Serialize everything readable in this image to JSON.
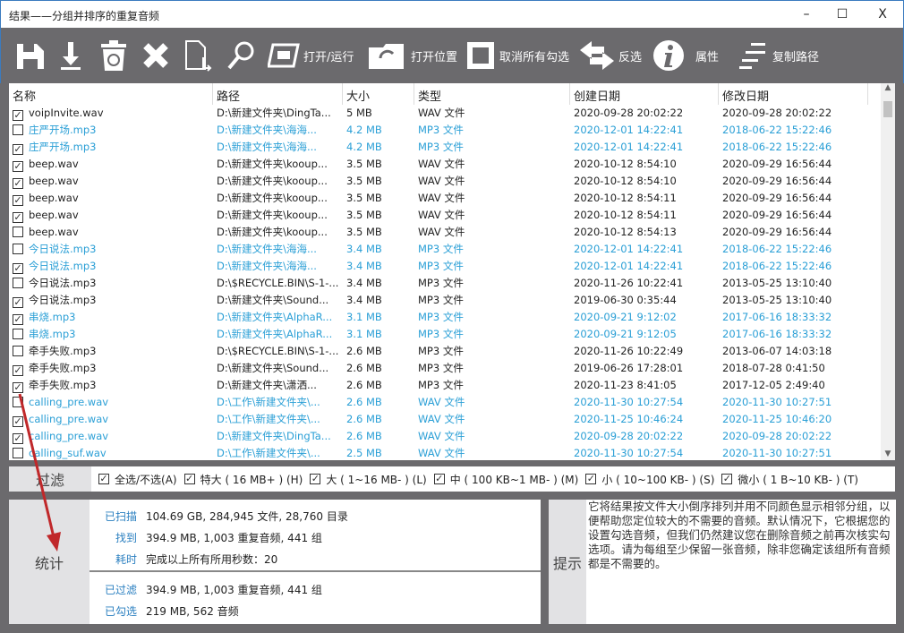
{
  "window": {
    "title": "结果——分组并排序的重复音频",
    "minimize": "–",
    "maximize": "☐",
    "close": "X"
  },
  "toolbar": {
    "open_run": "打开/运行",
    "open_location": "打开位置",
    "uncheck_all": "取消所有勾选",
    "invert": "反选",
    "properties": "属性",
    "copy_path": "复制路径"
  },
  "table": {
    "columns": [
      "名称",
      "路径",
      "大小",
      "类型",
      "创建日期",
      "修改日期"
    ],
    "rows": [
      {
        "checked": true,
        "blue": false,
        "cells": [
          "voipInvite.wav",
          "D:\\新建文件夹\\DingTa...",
          "5 MB",
          "WAV 文件",
          "2020-09-28 20:02:22",
          "2020-09-28 20:02:22"
        ]
      },
      {
        "checked": false,
        "blue": true,
        "cells": [
          "庄严开场.mp3",
          "D:\\新建文件夹\\海海...",
          "4.2 MB",
          "MP3 文件",
          "2020-12-01 14:22:41",
          "2018-06-22 15:22:46"
        ]
      },
      {
        "checked": true,
        "blue": true,
        "cells": [
          "庄严开场.mp3",
          "D:\\新建文件夹\\海海...",
          "4.2 MB",
          "MP3 文件",
          "2020-12-01 14:22:41",
          "2018-06-22 15:22:46"
        ]
      },
      {
        "checked": true,
        "blue": false,
        "cells": [
          "beep.wav",
          "D:\\新建文件夹\\kooup...",
          "3.5 MB",
          "WAV 文件",
          "2020-10-12 8:54:10",
          "2020-09-29 16:56:44"
        ]
      },
      {
        "checked": true,
        "blue": false,
        "cells": [
          "beep.wav",
          "D:\\新建文件夹\\kooup...",
          "3.5 MB",
          "WAV 文件",
          "2020-10-12 8:54:10",
          "2020-09-29 16:56:44"
        ]
      },
      {
        "checked": true,
        "blue": false,
        "cells": [
          "beep.wav",
          "D:\\新建文件夹\\kooup...",
          "3.5 MB",
          "WAV 文件",
          "2020-10-12 8:54:11",
          "2020-09-29 16:56:44"
        ]
      },
      {
        "checked": true,
        "blue": false,
        "cells": [
          "beep.wav",
          "D:\\新建文件夹\\kooup...",
          "3.5 MB",
          "WAV 文件",
          "2020-10-12 8:54:11",
          "2020-09-29 16:56:44"
        ]
      },
      {
        "checked": false,
        "blue": false,
        "cells": [
          "beep.wav",
          "D:\\新建文件夹\\kooup...",
          "3.5 MB",
          "WAV 文件",
          "2020-10-12 8:54:13",
          "2020-09-29 16:56:44"
        ]
      },
      {
        "checked": false,
        "blue": true,
        "cells": [
          "今日说法.mp3",
          "D:\\新建文件夹\\海海...",
          "3.4 MB",
          "MP3 文件",
          "2020-12-01 14:22:41",
          "2018-06-22 15:22:46"
        ]
      },
      {
        "checked": true,
        "blue": true,
        "cells": [
          "今日说法.mp3",
          "D:\\新建文件夹\\海海...",
          "3.4 MB",
          "MP3 文件",
          "2020-12-01 14:22:41",
          "2018-06-22 15:22:46"
        ]
      },
      {
        "checked": false,
        "blue": false,
        "cells": [
          "今日说法.mp3",
          "D:\\$RECYCLE.BIN\\S-1-...",
          "3.4 MB",
          "MP3 文件",
          "2020-11-26 10:22:41",
          "2013-05-25 13:10:40"
        ]
      },
      {
        "checked": true,
        "blue": false,
        "cells": [
          "今日说法.mp3",
          "D:\\新建文件夹\\Sound...",
          "3.4 MB",
          "MP3 文件",
          "2019-06-30 0:35:44",
          "2013-05-25 13:10:40"
        ]
      },
      {
        "checked": true,
        "blue": true,
        "cells": [
          "串烧.mp3",
          "D:\\新建文件夹\\AlphaR...",
          "3.1 MB",
          "MP3 文件",
          "2020-09-21 9:12:02",
          "2017-06-16 18:33:32"
        ]
      },
      {
        "checked": false,
        "blue": true,
        "cells": [
          "串烧.mp3",
          "D:\\新建文件夹\\AlphaR...",
          "3.1 MB",
          "MP3 文件",
          "2020-09-21 9:12:05",
          "2017-06-16 18:33:32"
        ]
      },
      {
        "checked": false,
        "blue": false,
        "cells": [
          "牵手失败.mp3",
          "D:\\$RECYCLE.BIN\\S-1-...",
          "2.6 MB",
          "MP3 文件",
          "2020-11-26 10:22:49",
          "2013-06-07 14:03:18"
        ]
      },
      {
        "checked": true,
        "blue": false,
        "cells": [
          "牵手失败.mp3",
          "D:\\新建文件夹\\Sound...",
          "2.6 MB",
          "MP3 文件",
          "2019-06-26 17:28:01",
          "2018-07-28 0:41:50"
        ]
      },
      {
        "checked": true,
        "blue": false,
        "cells": [
          "牵手失败.mp3",
          "D:\\新建文件夹\\潇洒...",
          "2.6 MB",
          "MP3 文件",
          "2020-11-23 8:41:05",
          "2017-12-05 2:49:40"
        ]
      },
      {
        "checked": false,
        "blue": true,
        "cells": [
          "calling_pre.wav",
          "D:\\工作\\新建文件夹\\...",
          "2.6 MB",
          "WAV 文件",
          "2020-11-30 10:27:54",
          "2020-11-30 10:27:51"
        ]
      },
      {
        "checked": true,
        "blue": true,
        "cells": [
          "calling_pre.wav",
          "D:\\工作\\新建文件夹\\...",
          "2.6 MB",
          "WAV 文件",
          "2020-11-25 10:46:24",
          "2020-11-25 10:46:20"
        ]
      },
      {
        "checked": true,
        "blue": true,
        "cells": [
          "calling_pre.wav",
          "D:\\新建文件夹\\DingTa...",
          "2.6 MB",
          "WAV 文件",
          "2020-09-28 20:02:22",
          "2020-09-28 20:02:22"
        ]
      },
      {
        "checked": false,
        "blue": true,
        "cells": [
          "calling_suf.wav",
          "D:\\工作\\新建文件夹\\...",
          "2.5 MB",
          "WAV 文件",
          "2020-11-30 10:27:54",
          "2020-11-30 10:27:51"
        ]
      }
    ]
  },
  "filter": {
    "label": "过滤",
    "options": [
      "全选/不选(A)",
      "特大 ( 16 MB+ ) (H)",
      "大 ( 1~16 MB- ) (L)",
      "中 ( 100 KB~1 MB- ) (M)",
      "小 ( 10~100 KB- ) (S)",
      "微小 ( 1 B~10 KB- ) (T)"
    ]
  },
  "stats": {
    "label": "统计",
    "rows": [
      {
        "key": "已扫描",
        "value": "104.69 GB, 284,945 文件, 28,760 目录"
      },
      {
        "key": "找到",
        "value": "394.9 MB, 1,003 重复音频, 441 组"
      },
      {
        "key": "耗时",
        "value": "完成以上所有所用秒数：20"
      },
      {
        "key": "已过滤",
        "value": "394.9 MB, 1,003 重复音频, 441 组"
      },
      {
        "key": "已勾选",
        "value": "219 MB, 562 音频"
      }
    ]
  },
  "tip": {
    "label": "提示",
    "text": "它将结果按文件大小倒序排列并用不同颜色显示相邻分组，以便帮助您定位较大的不需要的音频。默认情况下，它根据您的设置勾选音频，但我们仍然建议您在删除音频之前再次核实勾选项。请为每组至少保留一张音频，除非您确定该组所有音频都是不需要的。"
  },
  "colors": {
    "group_blue": "#2a9fd6",
    "toolbar_bg": "#6b6a6d",
    "annotation_arrow": "#c0282a"
  }
}
